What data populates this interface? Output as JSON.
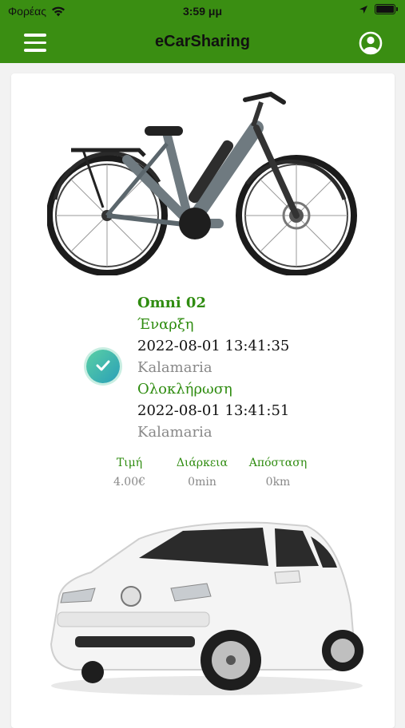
{
  "status_bar": {
    "carrier": "Φορέας",
    "time": "3:59 μμ",
    "icons": [
      "wifi-icon",
      "location-arrow-icon",
      "battery-icon"
    ]
  },
  "nav": {
    "title": "eCarSharing",
    "menu_icon": "hamburger-menu-icon",
    "profile_icon": "user-circle-icon"
  },
  "colors": {
    "nav_background": "#3a8e12",
    "accent_green": "#2f8c10",
    "muted_text": "#888888",
    "check_badge": "#3bb8a8"
  },
  "trip": {
    "vehicle_name": "Omni 02",
    "start_label": "Έναρξη",
    "start_datetime": "2022-08-01 13:41:35",
    "start_location": "Kalamaria",
    "end_label": "Ολοκλήρωση",
    "end_datetime": "2022-08-01 13:41:51",
    "end_location": "Kalamaria",
    "status_icon": "check-circle-icon"
  },
  "stats": [
    {
      "label": "Τιμή",
      "value": "4.00€"
    },
    {
      "label": "Διάρκεια",
      "value": "0min"
    },
    {
      "label": "Απόσταση",
      "value": "0km"
    }
  ]
}
